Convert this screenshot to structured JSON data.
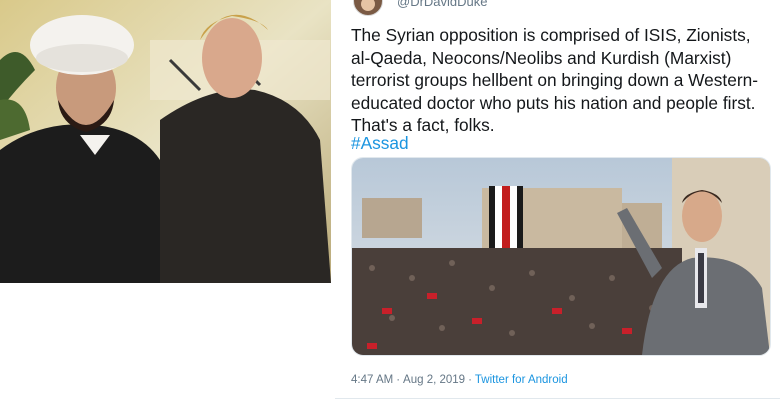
{
  "author": {
    "handle": "@DrDavidDuke"
  },
  "tweet": {
    "text": "The Syrian opposition is comprised of ISIS, Zionists, al-Qaeda, Neocons/Neolibs and Kurdish (Marxist) terrorist groups hellbent on bringing down a Western-educated doctor who puts his nation and people first. That's a fact, folks.",
    "hashtag": "#Assad",
    "time": "4:47 AM",
    "separator": "·",
    "date": "Aug 2, 2019",
    "source": "Twitter for Android"
  },
  "icons": {
    "avatar": "profile-avatar"
  },
  "colors": {
    "link": "#1b95e0",
    "text": "#14171a",
    "muted": "#657786"
  }
}
